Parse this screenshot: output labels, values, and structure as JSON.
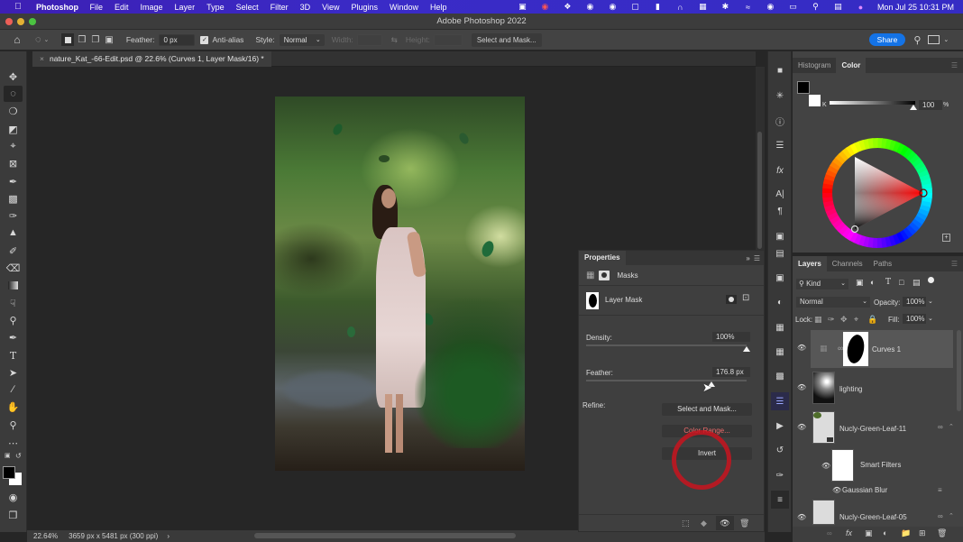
{
  "menubar": {
    "app_name": "Photoshop",
    "items": [
      "File",
      "Edit",
      "Image",
      "Layer",
      "Type",
      "Select",
      "Filter",
      "3D",
      "View",
      "Plugins",
      "Window",
      "Help"
    ],
    "clock": "Mon Jul 25  10:31 PM",
    "tray_icons": [
      "camera-icon",
      "screen-record-icon",
      "dropbox-icon",
      "globe-icon",
      "loom-icon",
      "screen-share-icon",
      "bookmark-icon",
      "creative-cloud-icon",
      "grid-app-icon",
      "bluetooth-icon",
      "wifi-icon",
      "user-icon",
      "battery-icon",
      "search-icon",
      "control-center-icon",
      "siri-icon"
    ]
  },
  "window": {
    "title": "Adobe Photoshop 2022"
  },
  "options_bar": {
    "feather_label": "Feather:",
    "feather_value": "0 px",
    "antialias_label": "Anti-alias",
    "antialias_checked": true,
    "style_label": "Style:",
    "style_value": "Normal",
    "width_label": "Width:",
    "height_label": "Height:",
    "select_mask_label": "Select and Mask...",
    "share_label": "Share"
  },
  "document": {
    "tab_title": "nature_Kat_-66-Edit.psd @ 22.6% (Curves 1, Layer Mask/16) *",
    "zoom": "22.64%",
    "dimensions": "3659 px x 5481 px (300 ppi)"
  },
  "tools": [
    "move",
    "elliptical-marquee",
    "lasso",
    "object-selection",
    "crop",
    "frame",
    "eyedropper",
    "spot-healing",
    "brush",
    "clone-stamp",
    "history-brush",
    "eraser",
    "gradient",
    "smudge",
    "dodge",
    "pen",
    "type",
    "path-selection",
    "line",
    "hand",
    "zoom",
    "more"
  ],
  "properties": {
    "title": "Properties",
    "section": "Masks",
    "mask_name": "Layer Mask",
    "density_label": "Density:",
    "density_value": "100%",
    "density_fraction": 1.0,
    "feather_label": "Feather:",
    "feather_value": "176.8 px",
    "feather_fraction": 0.78,
    "refine_label": "Refine:",
    "buttons": [
      "Select and Mask...",
      "Color Range...",
      "Invert"
    ]
  },
  "color_panel": {
    "tabs": [
      "Histogram",
      "Color"
    ],
    "active_tab": "Color",
    "channel_label": "K",
    "value": "100",
    "unit": "%",
    "foreground": "#000000",
    "background": "#ffffff"
  },
  "layers_panel": {
    "tabs": [
      "Layers",
      "Channels",
      "Paths"
    ],
    "active_tab": "Layers",
    "filter_label": "Kind",
    "blend_mode": "Normal",
    "opacity_label": "Opacity:",
    "opacity_value": "100%",
    "lock_label": "Lock:",
    "fill_label": "Fill:",
    "fill_value": "100%",
    "layers": [
      {
        "name": "Curves 1",
        "selected": true
      },
      {
        "name": "lighting",
        "selected": false
      },
      {
        "name": "Nucly-Green-Leaf-11",
        "selected": false
      },
      {
        "name": "Smart Filters",
        "selected": false
      },
      {
        "name": "Gaussian Blur",
        "selected": false
      },
      {
        "name": "Nucly-Green-Leaf-05",
        "selected": false
      }
    ]
  },
  "colors": {
    "accent": "#1473e6",
    "annotation_ring": "#c8141e",
    "menubar": "#3a2bc7"
  }
}
